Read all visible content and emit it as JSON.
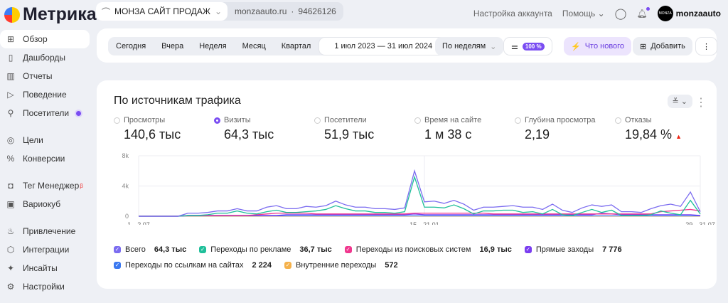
{
  "header": {
    "logo": "Метрика",
    "counter_name": "МОНЗА САЙТ ПРОДАЖ",
    "site": "monzaauto.ru",
    "counter_id": "94626126",
    "account_settings": "Настройка аккаунта",
    "help": "Помощь",
    "avatar_text": "MONZA",
    "username": "monzaauto"
  },
  "sidebar": {
    "items": [
      {
        "label": "Обзор",
        "icon": "grid-icon",
        "symbol": "⊞"
      },
      {
        "label": "Дашборды",
        "icon": "dashboards-icon",
        "symbol": "▯"
      },
      {
        "label": "Отчеты",
        "icon": "reports-icon",
        "symbol": "▥"
      },
      {
        "label": "Поведение",
        "icon": "play-icon",
        "symbol": "▷"
      },
      {
        "label": "Посетители",
        "icon": "visitors-icon",
        "symbol": "⚲"
      },
      {
        "label": "Цели",
        "icon": "target-icon",
        "symbol": "◎"
      },
      {
        "label": "Конверсии",
        "icon": "percent-icon",
        "symbol": "%"
      },
      {
        "label": "Тег Менеджер",
        "icon": "tag-manager-icon",
        "symbol": "◘",
        "badge": "β"
      },
      {
        "label": "Вариокуб",
        "icon": "variocube-icon",
        "symbol": "▣"
      },
      {
        "label": "Привлечение",
        "icon": "fire-icon",
        "symbol": "♨"
      },
      {
        "label": "Интеграции",
        "icon": "puzzle-icon",
        "symbol": "⬡"
      },
      {
        "label": "Инсайты",
        "icon": "sparkle-icon",
        "symbol": "✦"
      },
      {
        "label": "Настройки",
        "icon": "gear-icon",
        "symbol": "⚙"
      }
    ]
  },
  "toolbar": {
    "periods": [
      "Сегодня",
      "Вчера",
      "Неделя",
      "Месяц",
      "Квартал"
    ],
    "date_range": "1 июл 2023 — 31 июл 2024",
    "grouping": "По неделям",
    "sampling": "100 %",
    "whats_new": "Что нового",
    "add": "Добавить"
  },
  "report": {
    "title": "По источникам трафика",
    "metrics": [
      {
        "label": "Просмотры",
        "value": "140,6 тыс",
        "selected": false
      },
      {
        "label": "Визиты",
        "value": "64,3 тыс",
        "selected": true
      },
      {
        "label": "Посетители",
        "value": "51,9 тыс",
        "selected": false
      },
      {
        "label": "Время на сайте",
        "value": "1 м 38 с",
        "selected": false
      },
      {
        "label": "Глубина просмотра",
        "value": "2,19",
        "selected": false
      },
      {
        "label": "Отказы",
        "value": "19,84 %",
        "selected": false,
        "trend": "▲"
      }
    ]
  },
  "chart_data": {
    "type": "line",
    "y_ticks": [
      "0",
      "4k",
      "8k"
    ],
    "ylim": [
      0,
      8000
    ],
    "x_ticks": [
      "1—2.07",
      "15—21.01",
      "29—31.07"
    ],
    "grid": true,
    "series": [
      {
        "name": "Всего",
        "total": "64,3 тыс",
        "color": "#7b6cf0",
        "values": [
          0,
          0,
          0,
          0,
          0,
          0.4,
          0.4,
          0.5,
          0.7,
          0.7,
          1.0,
          0.7,
          0.7,
          1.2,
          1.4,
          1.0,
          1.0,
          1.3,
          1.2,
          1.4,
          2.0,
          1.5,
          1.2,
          1.2,
          1.0,
          1.0,
          0.9,
          1.1,
          6.0,
          1.9,
          2.0,
          1.7,
          2.1,
          1.6,
          0.8,
          1.2,
          1.2,
          1.3,
          1.4,
          1.2,
          1.2,
          0.9,
          1.6,
          0.8,
          0.5,
          1.1,
          1.5,
          1.3,
          1.5,
          0.6,
          0.6,
          0.5,
          1.0,
          1.4,
          1.6,
          1.3,
          3.2,
          0.6
        ]
      },
      {
        "name": "Переходы по рекламе",
        "total": "36,7 тыс",
        "color": "#1fbf9a",
        "values": [
          0,
          0,
          0,
          0,
          0,
          0.1,
          0.1,
          0.2,
          0.4,
          0.4,
          0.7,
          0.4,
          0.3,
          0.6,
          0.8,
          0.5,
          0.5,
          0.6,
          0.7,
          0.9,
          1.4,
          1.0,
          0.7,
          0.7,
          0.5,
          0.5,
          0.4,
          0.6,
          5.2,
          1.2,
          1.2,
          1.1,
          1.5,
          1.0,
          0.3,
          0.7,
          0.7,
          0.8,
          0.8,
          0.5,
          0.6,
          0.3,
          0.9,
          0.2,
          0.1,
          0.5,
          0.9,
          0.5,
          0.8,
          0.1,
          0.1,
          0.1,
          0.2,
          0.7,
          0.4,
          0.2,
          2.1,
          0.3
        ]
      },
      {
        "name": "Переходы из поисковых систем",
        "total": "16,9 тыс",
        "color": "#f0378e",
        "values": [
          0,
          0,
          0,
          0,
          0,
          0.1,
          0.1,
          0.1,
          0.1,
          0.1,
          0.1,
          0.1,
          0.2,
          0.3,
          0.4,
          0.4,
          0.4,
          0.4,
          0.3,
          0.3,
          0.3,
          0.3,
          0.3,
          0.3,
          0.3,
          0.3,
          0.3,
          0.3,
          0.4,
          0.4,
          0.4,
          0.4,
          0.4,
          0.4,
          0.4,
          0.4,
          0.3,
          0.3,
          0.3,
          0.3,
          0.3,
          0.3,
          0.3,
          0.3,
          0.3,
          0.3,
          0.3,
          0.3,
          0.3,
          0.3,
          0.3,
          0.3,
          0.3,
          0.6,
          0.7,
          0.8,
          0.9,
          0.7
        ]
      },
      {
        "name": "Прямые заходы",
        "total": "7 776",
        "color": "#7a3df0",
        "values": [
          0,
          0,
          0,
          0,
          0,
          0.1,
          0.1,
          0.1,
          0.1,
          0.1,
          0.1,
          0.1,
          0.1,
          0.1,
          0.1,
          0.2,
          0.2,
          0.2,
          0.2,
          0.2,
          0.2,
          0.2,
          0.2,
          0.2,
          0.2,
          0.2,
          0.2,
          0.2,
          0.3,
          0.2,
          0.2,
          0.2,
          0.2,
          0.2,
          0.2,
          0.2,
          0.2,
          0.2,
          0.2,
          0.2,
          0.2,
          0.2,
          0.2,
          0.2,
          0.2,
          0.2,
          0.2,
          0.4,
          0.3,
          0.2,
          0.2,
          0.2,
          0.2,
          0.2,
          0.2,
          0.2,
          0.2,
          0.1
        ]
      },
      {
        "name": "Переходы по ссылкам на сайтах",
        "total": "2 224",
        "color": "#3a78f0",
        "values": [
          0,
          0,
          0,
          0,
          0,
          0.05,
          0.05,
          0.05,
          0.05,
          0.05,
          0.05,
          0.05,
          0.05,
          0.05,
          0.05,
          0.05,
          0.05,
          0.05,
          0.05,
          0.05,
          0.05,
          0.05,
          0.05,
          0.05,
          0.05,
          0.05,
          0.05,
          0.05,
          0.05,
          0.05,
          0.05,
          0.05,
          0.05,
          0.05,
          0.05,
          0.05,
          0.05,
          0.05,
          0.05,
          0.05,
          0.05,
          0.05,
          0.05,
          0.05,
          0.05,
          0.05,
          0.05,
          0.05,
          0.05,
          0.05,
          0.05,
          0.05,
          0.05,
          0.05,
          0.05,
          0.05,
          0.05,
          0.05
        ]
      },
      {
        "name": "Внутренние переходы",
        "total": "572",
        "color": "#f5b14a",
        "values": [
          0.01,
          0.01,
          0.01,
          0.01,
          0.01,
          0.01,
          0.01,
          0.01,
          0.01,
          0.01,
          0.01,
          0.01,
          0.01,
          0.01,
          0.01,
          0.01,
          0.01,
          0.01,
          0.01,
          0.01,
          0.01,
          0.01,
          0.01,
          0.01,
          0.01,
          0.01,
          0.01,
          0.01,
          0.01,
          0.01,
          0.01,
          0.01,
          0.01,
          0.01,
          0.01,
          0.01,
          0.01,
          0.01,
          0.01,
          0.01,
          0.01,
          0.01,
          0.01,
          0.01,
          0.01,
          0.01,
          0.01,
          0.01,
          0.01,
          0.01,
          0.01,
          0.01,
          0.01,
          0.01,
          0.01,
          0.01,
          0.01,
          0.01
        ]
      }
    ]
  }
}
